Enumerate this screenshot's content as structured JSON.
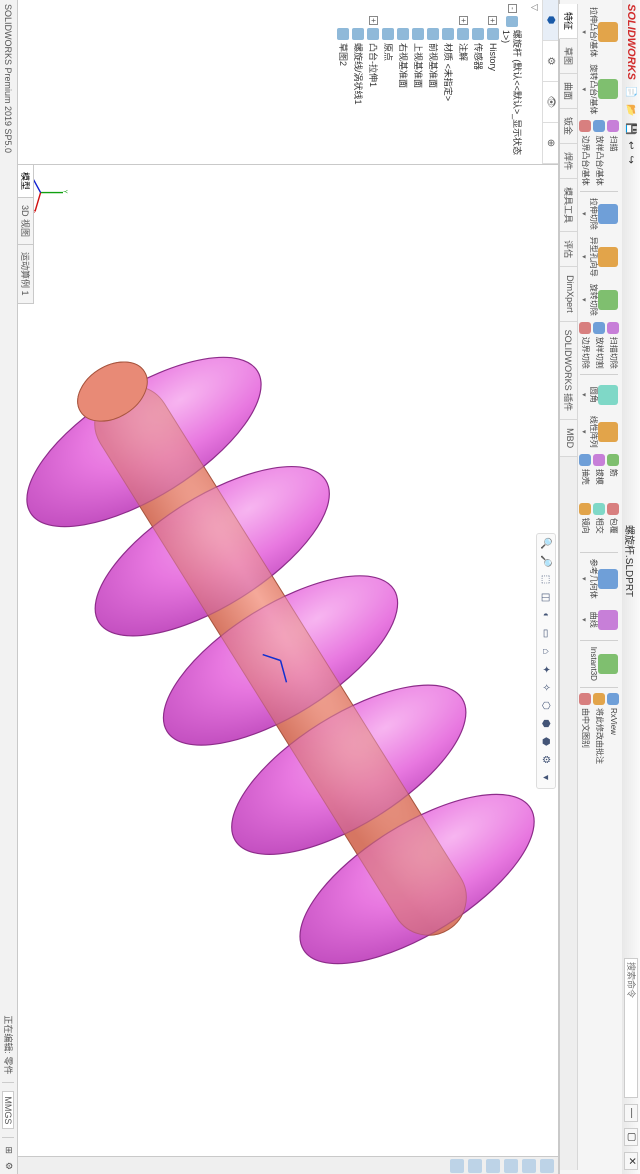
{
  "app": {
    "logo": "SOLIDWORKS",
    "title_doc": "螺旋杆.SLDPRT",
    "search_placeholder": "搜索命令"
  },
  "ribbon": {
    "row1": [
      {
        "label": "拉伸凸台/基体",
        "dd": "▾"
      },
      {
        "label": "旋转凸台/基体",
        "dd": "▾"
      }
    ],
    "row1_stack": [
      {
        "label": "扫描"
      },
      {
        "label": "放样凸台/基体"
      },
      {
        "label": "边界凸台/基体"
      }
    ],
    "row2": [
      {
        "label": "拉伸切除",
        "dd": "▾"
      },
      {
        "label": "异型孔向导",
        "dd": "▾"
      },
      {
        "label": "旋转切除",
        "dd": "▾"
      }
    ],
    "row2_stack": [
      {
        "label": "扫描切除"
      },
      {
        "label": "放样切割"
      },
      {
        "label": "边界切除"
      }
    ],
    "row3": [
      {
        "label": "圆角",
        "dd": "▾"
      },
      {
        "label": "线性阵列",
        "dd": "▾"
      }
    ],
    "row3_stack": [
      {
        "label": "筋"
      },
      {
        "label": "拔模"
      },
      {
        "label": "抽壳"
      }
    ],
    "row3_stack2": [
      {
        "label": "包覆"
      },
      {
        "label": "相交"
      },
      {
        "label": "镜向"
      }
    ],
    "row4": [
      {
        "label": "参考几何体",
        "dd": "▾"
      },
      {
        "label": "曲线",
        "dd": "▾"
      }
    ],
    "row5": [
      {
        "label": "Instant3D"
      }
    ],
    "row6_stack": [
      {
        "label": "RxView"
      },
      {
        "label": "将此修改由批注"
      },
      {
        "label": "由中文图别"
      }
    ]
  },
  "tabs": [
    "特征",
    "草图",
    "曲面",
    "钣金",
    "焊件",
    "模具工具",
    "评估",
    "DimXpert",
    "SOLIDWORKS 插件",
    "MBD"
  ],
  "active_tab": 0,
  "tree": {
    "tabs_icons": [
      "feature",
      "config",
      "display",
      "hide"
    ],
    "root": "螺旋杆 (默认<<默认>_显示状态 1>)",
    "items": [
      {
        "label": "History",
        "exp": "+",
        "ind": 1,
        "icon": "c4"
      },
      {
        "label": "传感器",
        "ind": 1,
        "icon": "c4"
      },
      {
        "label": "注解",
        "exp": "+",
        "ind": 1,
        "icon": "c1"
      },
      {
        "label": "材质 <未指定>",
        "ind": 1,
        "icon": "c2"
      },
      {
        "label": "前视基准面",
        "ind": 1,
        "icon": "c4"
      },
      {
        "label": "上视基准面",
        "ind": 1,
        "icon": "c4"
      },
      {
        "label": "右视基准面",
        "ind": 1,
        "icon": "c4"
      },
      {
        "label": "原点",
        "ind": 1,
        "icon": "c5"
      },
      {
        "label": "凸台-拉伸1",
        "exp": "+",
        "ind": 1,
        "icon": "c1"
      },
      {
        "label": "螺旋线/涡状线1",
        "ind": 1,
        "icon": "c3"
      },
      {
        "label": "草图2",
        "ind": 1,
        "icon": "c4"
      }
    ]
  },
  "viewport_tools": [
    "🔍",
    "🔎",
    "⬚",
    "◫",
    "◐",
    "▭",
    "⌂",
    "✦",
    "✧",
    "⬡",
    "⬢",
    "⬣",
    "⚙",
    "▾"
  ],
  "bottom_tabs": [
    "模型",
    "3D 视图",
    "运动算例 1"
  ],
  "status": {
    "left": "SOLIDWORKS Premium 2019 SP5.0",
    "edit_label": "正在编辑: 零件",
    "units": "MMGS"
  }
}
